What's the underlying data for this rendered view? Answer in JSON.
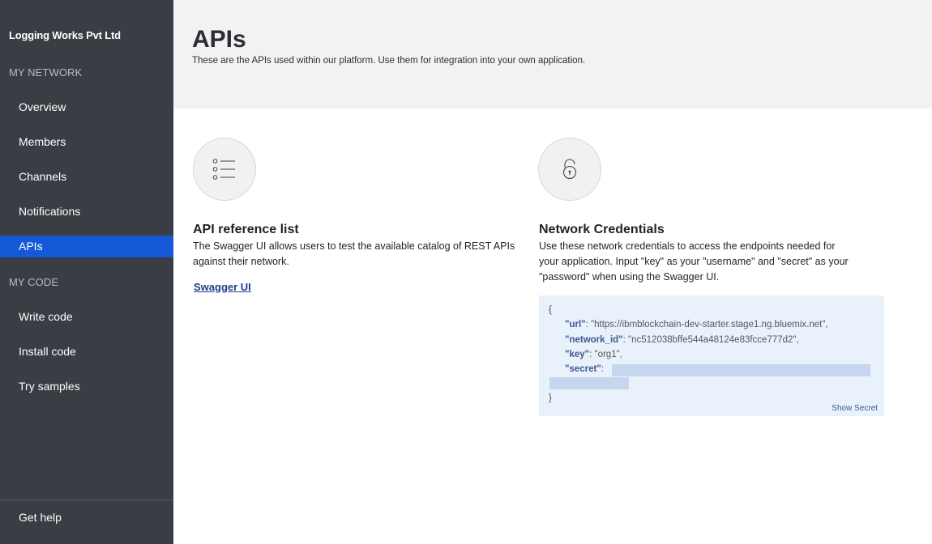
{
  "sidebar": {
    "org_name": "Logging Works Pvt Ltd",
    "section_network": "MY NETWORK",
    "items_network": [
      {
        "label": "Overview"
      },
      {
        "label": "Members"
      },
      {
        "label": "Channels"
      },
      {
        "label": "Notifications"
      },
      {
        "label": "APIs"
      }
    ],
    "section_code": "MY CODE",
    "items_code": [
      {
        "label": "Write code"
      },
      {
        "label": "Install code"
      },
      {
        "label": "Try samples"
      }
    ],
    "help_label": "Get help",
    "active_item": "APIs",
    "active_color": "#1659d6"
  },
  "header": {
    "title": "APIs",
    "subtitle": "These are the APIs used within our platform. Use them for integration into your own application."
  },
  "api_reference": {
    "icon": "list-icon",
    "title": "API reference list",
    "description_line1": "The Swagger UI allows users to test the available catalog of REST APIs",
    "description_line2": "against their network.",
    "link_label": "Swagger UI"
  },
  "network_credentials": {
    "icon": "unlocked-padlock-icon",
    "title": "Network Credentials",
    "description_line1": "Use these network credentials to access the endpoints needed for",
    "description_line2": "your application. Input \"key\" as your \"username\" and \"secret\" as your",
    "description_line3": "\"password\" when using the Swagger UI.",
    "code": {
      "open_brace": "{",
      "close_brace": "}",
      "url_key": "\"url\"",
      "url_value": "\"https://ibmblockchain-dev-starter.stage1.ng.bluemix.net\",",
      "network_id_key": "\"network_id\"",
      "network_id_value": "\"nc512038bffe544a48124e83fcce777d2\",",
      "key_key": "\"key\"",
      "key_value": "\"org1\",",
      "secret_key": "\"secret\"",
      "colon": ":"
    },
    "show_secret_label": "Show Secret"
  }
}
